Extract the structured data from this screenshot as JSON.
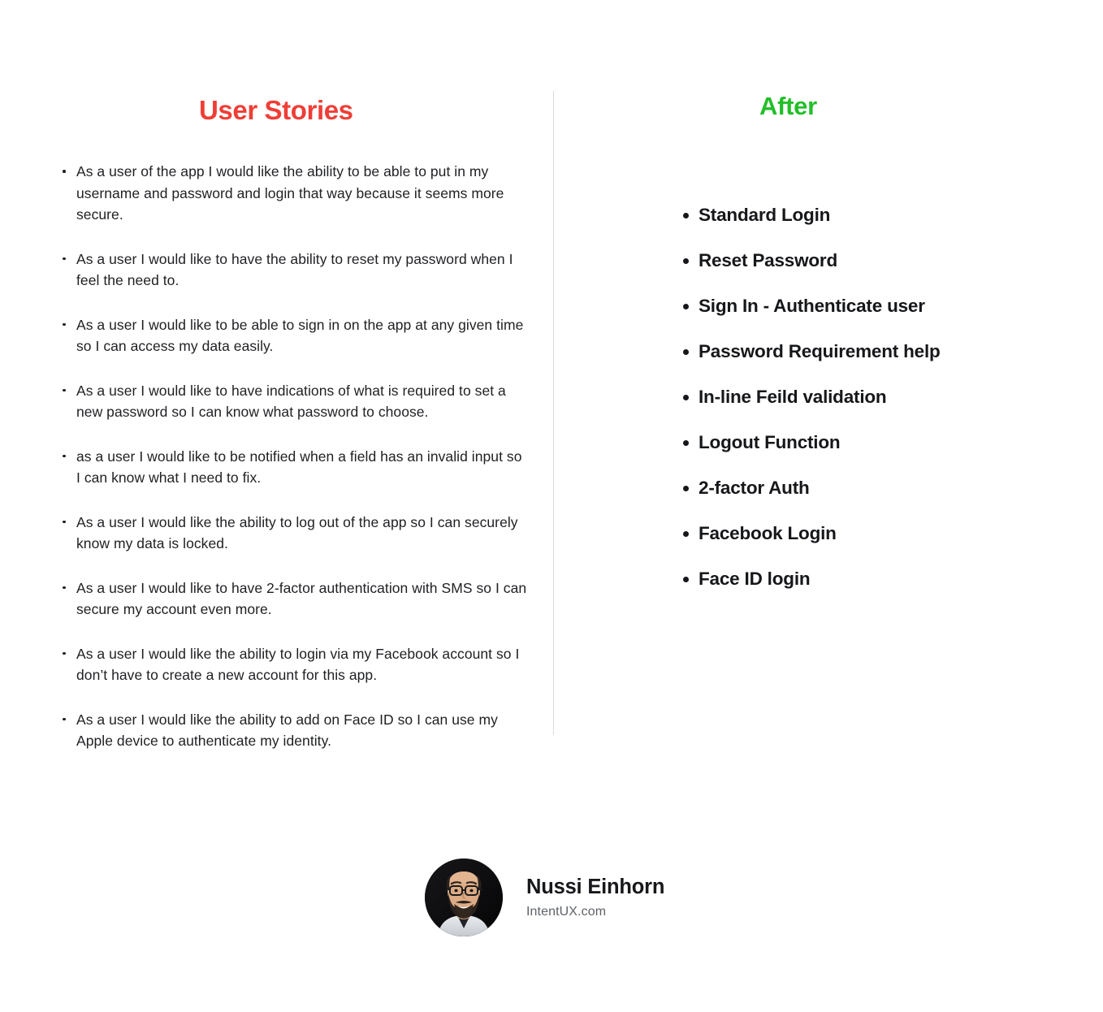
{
  "left_column": {
    "heading": "User Stories",
    "heading_color": "#ef3e36",
    "stories": [
      "As a user of the app I would like the ability to be able to put in my username and password and login that way because it seems more secure.",
      "As a user I would like to have the ability to reset my password when I feel the need to.",
      "As a user I would like to be able to sign in on the app at any given time so I can access my data easily.",
      "As a user I would like to have indications of what is required to set a new password so I can know what password to choose.",
      "as a user I would like to be notified when a field has an invalid input so I can know what I need to fix.",
      "As a user I would like the ability to log out of the app so I can securely know my data is locked.",
      "As a user I would like to have 2-factor authentication with SMS so I can secure my account even more.",
      "As a user I would like the ability to login via my Facebook account so I don’t have to create a new account for this app.",
      "As a user I would like the ability to add on Face ID so I can use my Apple device to authenticate my identity."
    ]
  },
  "right_column": {
    "heading": "After",
    "heading_color": "#22bf28",
    "features": [
      "Standard Login",
      "Reset Password",
      "Sign In - Authenticate user",
      "Password Requirement help",
      "In-line Feild validation",
      "Logout Function",
      "2-factor Auth",
      "Facebook Login",
      "Face ID login"
    ]
  },
  "footer": {
    "avatar_icon": "person-photo-avatar",
    "name": "Nussi Einhorn",
    "website": "IntentUX.com"
  }
}
